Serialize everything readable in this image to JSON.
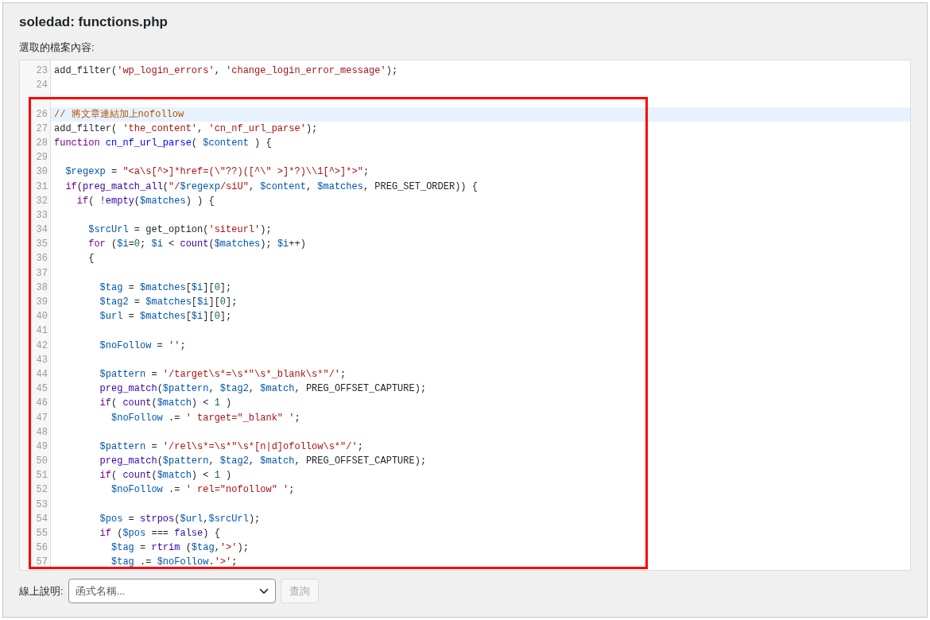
{
  "title": "soledad: functions.php",
  "content_label": "選取的檔案內容:",
  "editor": {
    "lines": [
      {
        "number": "23",
        "active": false,
        "tokens": [
          {
            "kind": "plain",
            "text": "add_filter("
          },
          {
            "kind": "string",
            "text": "'wp_login_errors'"
          },
          {
            "kind": "plain",
            "text": ", "
          },
          {
            "kind": "string",
            "text": "'change_login_error_message'"
          },
          {
            "kind": "plain",
            "text": ");"
          }
        ]
      },
      {
        "number": "24",
        "active": false
      },
      {
        "active": false
      },
      {
        "number": "26",
        "active": true,
        "tokens": [
          {
            "kind": "comment",
            "text": "// 將文章連結加上nofollow"
          }
        ]
      },
      {
        "number": "27",
        "active": false,
        "tokens": [
          {
            "kind": "plain",
            "text": "add_filter( "
          },
          {
            "kind": "string",
            "text": "'the_content'"
          },
          {
            "kind": "plain",
            "text": ", "
          },
          {
            "kind": "string",
            "text": "'cn_nf_url_parse'"
          },
          {
            "kind": "plain",
            "text": ");"
          }
        ]
      },
      {
        "number": "28",
        "active": false,
        "tokens": [
          {
            "kind": "keyword",
            "text": "function "
          },
          {
            "kind": "def",
            "text": "cn_nf_url_parse"
          },
          {
            "kind": "plain",
            "text": "( "
          },
          {
            "kind": "variable",
            "text": "$content"
          },
          {
            "kind": "plain",
            "text": " ) {"
          }
        ]
      },
      {
        "number": "29",
        "active": false
      },
      {
        "number": "30",
        "active": false,
        "tokens": [
          {
            "kind": "variable",
            "text": "  $regexp"
          },
          {
            "kind": "plain",
            "text": " = "
          },
          {
            "kind": "string",
            "text": "\"<a\\s[^>]*href=(\\\"??)([^\\\" >]*?)\\\\1[^>]*>\""
          },
          {
            "kind": "plain",
            "text": ";"
          }
        ]
      },
      {
        "number": "31",
        "active": false,
        "tokens": [
          {
            "kind": "keyword",
            "text": "  if"
          },
          {
            "kind": "plain",
            "text": "("
          },
          {
            "kind": "builtin",
            "text": "preg_match_all"
          },
          {
            "kind": "plain",
            "text": "("
          },
          {
            "kind": "string",
            "text": "\"/"
          },
          {
            "kind": "variable",
            "text": "$regexp"
          },
          {
            "kind": "string",
            "text": "/siU\""
          },
          {
            "kind": "plain",
            "text": ", "
          },
          {
            "kind": "variable",
            "text": "$content"
          },
          {
            "kind": "plain",
            "text": ", "
          },
          {
            "kind": "variable",
            "text": "$matches"
          },
          {
            "kind": "plain",
            "text": ", PREG_SET_ORDER)) {"
          }
        ]
      },
      {
        "number": "32",
        "active": false,
        "tokens": [
          {
            "kind": "keyword",
            "text": "    if"
          },
          {
            "kind": "plain",
            "text": "( !"
          },
          {
            "kind": "builtin",
            "text": "empty"
          },
          {
            "kind": "plain",
            "text": "("
          },
          {
            "kind": "variable",
            "text": "$matches"
          },
          {
            "kind": "plain",
            "text": ") ) {"
          }
        ]
      },
      {
        "number": "33",
        "active": false
      },
      {
        "number": "34",
        "active": false,
        "tokens": [
          {
            "kind": "variable",
            "text": "      $srcUrl"
          },
          {
            "kind": "plain",
            "text": " = get_option("
          },
          {
            "kind": "string",
            "text": "'siteurl'"
          },
          {
            "kind": "plain",
            "text": ");"
          }
        ]
      },
      {
        "number": "35",
        "active": false,
        "tokens": [
          {
            "kind": "keyword",
            "text": "      for"
          },
          {
            "kind": "plain",
            "text": " ("
          },
          {
            "kind": "variable",
            "text": "$i"
          },
          {
            "kind": "plain",
            "text": "="
          },
          {
            "kind": "number",
            "text": "0"
          },
          {
            "kind": "plain",
            "text": "; "
          },
          {
            "kind": "variable",
            "text": "$i"
          },
          {
            "kind": "plain",
            "text": " < "
          },
          {
            "kind": "builtin",
            "text": "count"
          },
          {
            "kind": "plain",
            "text": "("
          },
          {
            "kind": "variable",
            "text": "$matches"
          },
          {
            "kind": "plain",
            "text": "); "
          },
          {
            "kind": "variable",
            "text": "$i"
          },
          {
            "kind": "plain",
            "text": "++)"
          }
        ]
      },
      {
        "number": "36",
        "active": false,
        "tokens": [
          {
            "kind": "plain",
            "text": "      {"
          }
        ]
      },
      {
        "number": "37",
        "active": false
      },
      {
        "number": "38",
        "active": false,
        "tokens": [
          {
            "kind": "variable",
            "text": "        $tag"
          },
          {
            "kind": "plain",
            "text": " = "
          },
          {
            "kind": "variable",
            "text": "$matches"
          },
          {
            "kind": "plain",
            "text": "["
          },
          {
            "kind": "variable",
            "text": "$i"
          },
          {
            "kind": "plain",
            "text": "]["
          },
          {
            "kind": "number",
            "text": "0"
          },
          {
            "kind": "plain",
            "text": "];"
          }
        ]
      },
      {
        "number": "39",
        "active": false,
        "tokens": [
          {
            "kind": "variable",
            "text": "        $tag2"
          },
          {
            "kind": "plain",
            "text": " = "
          },
          {
            "kind": "variable",
            "text": "$matches"
          },
          {
            "kind": "plain",
            "text": "["
          },
          {
            "kind": "variable",
            "text": "$i"
          },
          {
            "kind": "plain",
            "text": "]["
          },
          {
            "kind": "number",
            "text": "0"
          },
          {
            "kind": "plain",
            "text": "];"
          }
        ]
      },
      {
        "number": "40",
        "active": false,
        "tokens": [
          {
            "kind": "variable",
            "text": "        $url"
          },
          {
            "kind": "plain",
            "text": " = "
          },
          {
            "kind": "variable",
            "text": "$matches"
          },
          {
            "kind": "plain",
            "text": "["
          },
          {
            "kind": "variable",
            "text": "$i"
          },
          {
            "kind": "plain",
            "text": "]["
          },
          {
            "kind": "number",
            "text": "0"
          },
          {
            "kind": "plain",
            "text": "];"
          }
        ]
      },
      {
        "number": "41",
        "active": false
      },
      {
        "number": "42",
        "active": false,
        "tokens": [
          {
            "kind": "variable",
            "text": "        $noFollow"
          },
          {
            "kind": "plain",
            "text": " = "
          },
          {
            "kind": "string",
            "text": "''"
          },
          {
            "kind": "plain",
            "text": ";"
          }
        ]
      },
      {
        "number": "43",
        "active": false
      },
      {
        "number": "44",
        "active": false,
        "tokens": [
          {
            "kind": "variable",
            "text": "        $pattern"
          },
          {
            "kind": "plain",
            "text": " = "
          },
          {
            "kind": "string",
            "text": "'/target\\s*=\\s*\"\\s*_blank\\s*\"/'"
          },
          {
            "kind": "plain",
            "text": ";"
          }
        ]
      },
      {
        "number": "45",
        "active": false,
        "tokens": [
          {
            "kind": "builtin",
            "text": "        preg_match"
          },
          {
            "kind": "plain",
            "text": "("
          },
          {
            "kind": "variable",
            "text": "$pattern"
          },
          {
            "kind": "plain",
            "text": ", "
          },
          {
            "kind": "variable",
            "text": "$tag2"
          },
          {
            "kind": "plain",
            "text": ", "
          },
          {
            "kind": "variable",
            "text": "$match"
          },
          {
            "kind": "plain",
            "text": ", PREG_OFFSET_CAPTURE);"
          }
        ]
      },
      {
        "number": "46",
        "active": false,
        "tokens": [
          {
            "kind": "keyword",
            "text": "        if"
          },
          {
            "kind": "plain",
            "text": "( "
          },
          {
            "kind": "builtin",
            "text": "count"
          },
          {
            "kind": "plain",
            "text": "("
          },
          {
            "kind": "variable",
            "text": "$match"
          },
          {
            "kind": "plain",
            "text": ") < "
          },
          {
            "kind": "number",
            "text": "1"
          },
          {
            "kind": "plain",
            "text": " )"
          }
        ]
      },
      {
        "number": "47",
        "active": false,
        "tokens": [
          {
            "kind": "variable",
            "text": "          $noFollow"
          },
          {
            "kind": "plain",
            "text": " .= "
          },
          {
            "kind": "string",
            "text": "' target=\"_blank\" '"
          },
          {
            "kind": "plain",
            "text": ";"
          }
        ]
      },
      {
        "number": "48",
        "active": false
      },
      {
        "number": "49",
        "active": false,
        "tokens": [
          {
            "kind": "variable",
            "text": "        $pattern"
          },
          {
            "kind": "plain",
            "text": " = "
          },
          {
            "kind": "string",
            "text": "'/rel\\s*=\\s*\"\\s*[n|d]ofollow\\s*\"/'"
          },
          {
            "kind": "plain",
            "text": ";"
          }
        ]
      },
      {
        "number": "50",
        "active": false,
        "tokens": [
          {
            "kind": "builtin",
            "text": "        preg_match"
          },
          {
            "kind": "plain",
            "text": "("
          },
          {
            "kind": "variable",
            "text": "$pattern"
          },
          {
            "kind": "plain",
            "text": ", "
          },
          {
            "kind": "variable",
            "text": "$tag2"
          },
          {
            "kind": "plain",
            "text": ", "
          },
          {
            "kind": "variable",
            "text": "$match"
          },
          {
            "kind": "plain",
            "text": ", PREG_OFFSET_CAPTURE);"
          }
        ]
      },
      {
        "number": "51",
        "active": false,
        "tokens": [
          {
            "kind": "keyword",
            "text": "        if"
          },
          {
            "kind": "plain",
            "text": "( "
          },
          {
            "kind": "builtin",
            "text": "count"
          },
          {
            "kind": "plain",
            "text": "("
          },
          {
            "kind": "variable",
            "text": "$match"
          },
          {
            "kind": "plain",
            "text": ") < "
          },
          {
            "kind": "number",
            "text": "1"
          },
          {
            "kind": "plain",
            "text": " )"
          }
        ]
      },
      {
        "number": "52",
        "active": false,
        "tokens": [
          {
            "kind": "variable",
            "text": "          $noFollow"
          },
          {
            "kind": "plain",
            "text": " .= "
          },
          {
            "kind": "string",
            "text": "' rel=\"nofollow\" '"
          },
          {
            "kind": "plain",
            "text": ";"
          }
        ]
      },
      {
        "number": "53",
        "active": false
      },
      {
        "number": "54",
        "active": false,
        "tokens": [
          {
            "kind": "variable",
            "text": "        $pos"
          },
          {
            "kind": "plain",
            "text": " = "
          },
          {
            "kind": "builtin",
            "text": "strpos"
          },
          {
            "kind": "plain",
            "text": "("
          },
          {
            "kind": "variable",
            "text": "$url"
          },
          {
            "kind": "plain",
            "text": ","
          },
          {
            "kind": "variable",
            "text": "$srcUrl"
          },
          {
            "kind": "plain",
            "text": ");"
          }
        ]
      },
      {
        "number": "55",
        "active": false,
        "tokens": [
          {
            "kind": "keyword",
            "text": "        if"
          },
          {
            "kind": "plain",
            "text": " ("
          },
          {
            "kind": "variable",
            "text": "$pos"
          },
          {
            "kind": "plain",
            "text": " === "
          },
          {
            "kind": "atom",
            "text": "false"
          },
          {
            "kind": "plain",
            "text": ") {"
          }
        ]
      },
      {
        "number": "56",
        "active": false,
        "tokens": [
          {
            "kind": "variable",
            "text": "          $tag"
          },
          {
            "kind": "plain",
            "text": " = "
          },
          {
            "kind": "builtin",
            "text": "rtrim"
          },
          {
            "kind": "plain",
            "text": " ("
          },
          {
            "kind": "variable",
            "text": "$tag"
          },
          {
            "kind": "plain",
            "text": ","
          },
          {
            "kind": "string",
            "text": "'>'"
          },
          {
            "kind": "plain",
            "text": ");"
          }
        ]
      },
      {
        "number": "57",
        "active": false,
        "tokens": [
          {
            "kind": "variable",
            "text": "          $tag"
          },
          {
            "kind": "plain",
            "text": " .= "
          },
          {
            "kind": "variable",
            "text": "$noFollow"
          },
          {
            "kind": "plain",
            "text": "."
          },
          {
            "kind": "string",
            "text": "'>'"
          },
          {
            "kind": "plain",
            "text": ";"
          }
        ]
      }
    ]
  },
  "doc_lookup": {
    "label": "線上說明:",
    "select": {
      "placeholder": "函式名稱..."
    },
    "button": {
      "label": "查詢",
      "disabled": true
    }
  }
}
